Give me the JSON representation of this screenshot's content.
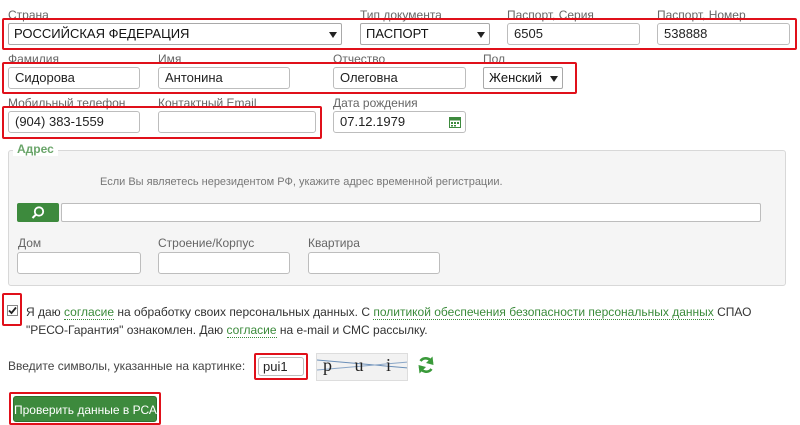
{
  "row1": {
    "country_label": "Страна",
    "country_value": "РОССИЙСКАЯ ФЕДЕРАЦИЯ",
    "doc_type_label": "Тип документа",
    "doc_type_value": "ПАСПОРТ",
    "series_label": "Паспорт, Серия",
    "series_value": "6505",
    "number_label": "Паспорт, Номер",
    "number_value": "538888"
  },
  "row2": {
    "last_name_label": "Фамилия",
    "last_name_value": "Сидорова",
    "first_name_label": "Имя",
    "first_name_value": "Антонина",
    "middle_name_label": "Отчество",
    "middle_name_value": "Олеговна",
    "gender_label": "Пол",
    "gender_value": "Женский"
  },
  "row3": {
    "phone_label": "Мобильный телефон",
    "phone_value": "(904) 383-1559",
    "email_label": "Контактный Email",
    "email_value": "",
    "birth_label": "Дата рождения",
    "birth_value": "07.12.1979"
  },
  "address": {
    "legend": "Адрес",
    "hint": "Если Вы являетесь нерезидентом РФ, укажите адрес временной регистрации.",
    "search_value": "",
    "house_label": "Дом",
    "building_label": "Строение/Корпус",
    "apartment_label": "Квартира"
  },
  "consent": {
    "t1": "Я даю ",
    "l1": "согласие",
    "t2": " на обработку своих персональных данных. С ",
    "l2": "политикой обеспечения безопасности персональных данных",
    "t3": " СПАО \"РЕСО-Гарантия\" ознакомлен. Даю ",
    "l3": "согласие",
    "t4": " на e-mail и СМС рассылку.",
    "checked": true
  },
  "captcha": {
    "label": "Введите символы, указанные на картинке:",
    "value": "pui1",
    "image_text": "p u i 1"
  },
  "submit_label": "Проверить данные в РСА",
  "colors": {
    "accent": "#3d8a3d",
    "highlight": "#e0101a"
  }
}
